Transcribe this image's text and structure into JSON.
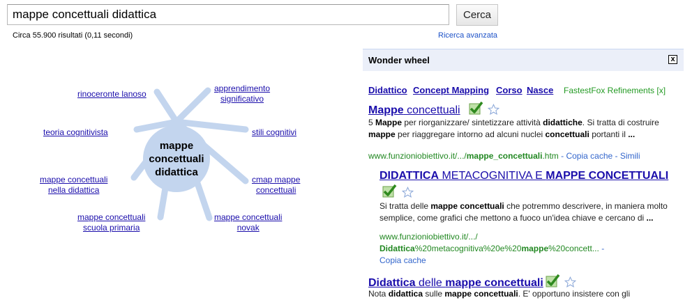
{
  "search": {
    "query": "mappe concettuali didattica",
    "button": "Cerca"
  },
  "stats": "Circa 55.900 risultati (0,11 secondi)",
  "advanced": "Ricerca avanzata",
  "wheel": {
    "center_lines": [
      "mappe",
      "concettuali",
      "didattica"
    ],
    "spokes": [
      {
        "lines": [
          "rinoceronte lanoso"
        ]
      },
      {
        "lines": [
          "apprendimento",
          "significativo"
        ]
      },
      {
        "lines": [
          "teoria cognitivista"
        ]
      },
      {
        "lines": [
          "stili cognitivi"
        ]
      },
      {
        "lines": [
          "mappe concettuali",
          "nella didattica"
        ]
      },
      {
        "lines": [
          "cmap mappe",
          "concettuali"
        ]
      },
      {
        "lines": [
          "mappe concettuali",
          "scuola primaria"
        ]
      },
      {
        "lines": [
          "mappe concettuali",
          "novak"
        ]
      }
    ]
  },
  "panel": {
    "title": "Wonder wheel",
    "close": "x"
  },
  "related": [
    "Didattico",
    "Concept Mapping",
    "Corso",
    "Nasce"
  ],
  "fastestfox": "FastestFox Refinements [x]",
  "results": [
    {
      "title": [
        "Mappe",
        " concettuali"
      ],
      "snippet": [
        "5 ",
        "Mappe",
        " per riorganizzare/ sintetizzare attività ",
        "didattiche",
        ". Si tratta di costruire ",
        "mappe",
        " per riaggregare intorno ad alcuni nuclei ",
        "concettuali",
        " portanti il ",
        "..."
      ],
      "url": [
        "www.funzioniobiettivo.it/.../",
        "mappe_concettuali",
        ".htm"
      ],
      "links": [
        " - ",
        "Copia cache",
        " - ",
        "Simili"
      ]
    },
    {
      "title": [
        "DIDATTICA",
        " METACOGNITIVA E ",
        "MAPPE CONCETTUALI"
      ],
      "snippet": [
        "Si tratta delle ",
        "mappe concettuali",
        " che potremmo descrivere, in maniera molto semplice, come grafici che mettono a fuoco un'idea chiave e cercano di ",
        "..."
      ],
      "url_line1": "www.funzioniobiettivo.it/.../",
      "url_line2": [
        "Didattica",
        "%20metacognitiva%20e%20",
        "mappe",
        "%20concett...",
        " -"
      ],
      "cache": "Copia cache"
    },
    {
      "title": [
        "Didattica",
        " delle ",
        "mappe concettuali"
      ],
      "snippet": [
        "Nota ",
        "didattica",
        " sulle ",
        "mappe concettuali",
        ". E' opportuno insistere con gli"
      ]
    }
  ],
  "colors": {
    "link": "#1a0dab",
    "url": "#228822",
    "spoke": "#c3d5ee",
    "hub": "#c3d5ee",
    "panel_bg": "#ebeff9"
  }
}
